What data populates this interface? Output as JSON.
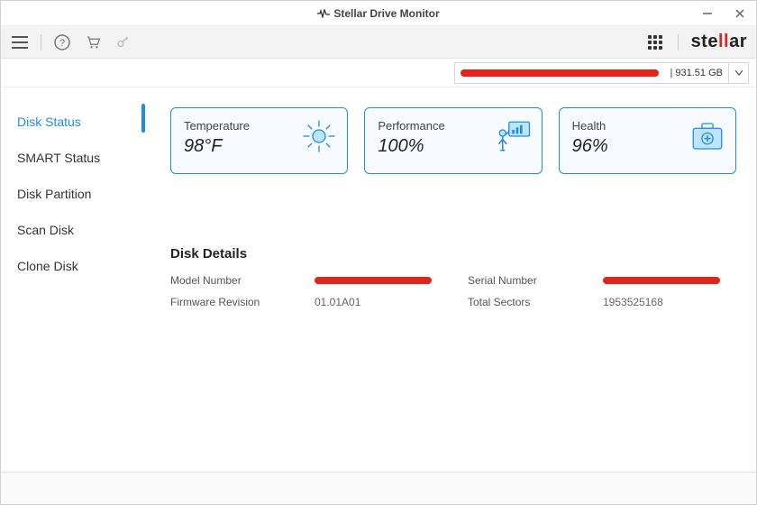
{
  "window": {
    "title": "Stellar Drive Monitor"
  },
  "brand": {
    "prefix": "ste",
    "accent": "ll",
    "suffix": "ar"
  },
  "drive_selector": {
    "size": "| 931.51 GB"
  },
  "sidebar": {
    "items": [
      {
        "label": "Disk Status",
        "active": true
      },
      {
        "label": "SMART Status"
      },
      {
        "label": "Disk Partition"
      },
      {
        "label": "Scan Disk"
      },
      {
        "label": "Clone Disk"
      }
    ]
  },
  "cards": {
    "temperature": {
      "label": "Temperature",
      "value": "98°F"
    },
    "performance": {
      "label": "Performance",
      "value": "100%"
    },
    "health": {
      "label": "Health",
      "value": "96%"
    }
  },
  "disk_details": {
    "heading": "Disk Details",
    "model_number_label": "Model Number",
    "firmware_label": "Firmware Revision",
    "firmware_value": "01.01A01",
    "serial_label": "Serial Number",
    "sectors_label": "Total Sectors",
    "sectors_value": "1953525168"
  }
}
